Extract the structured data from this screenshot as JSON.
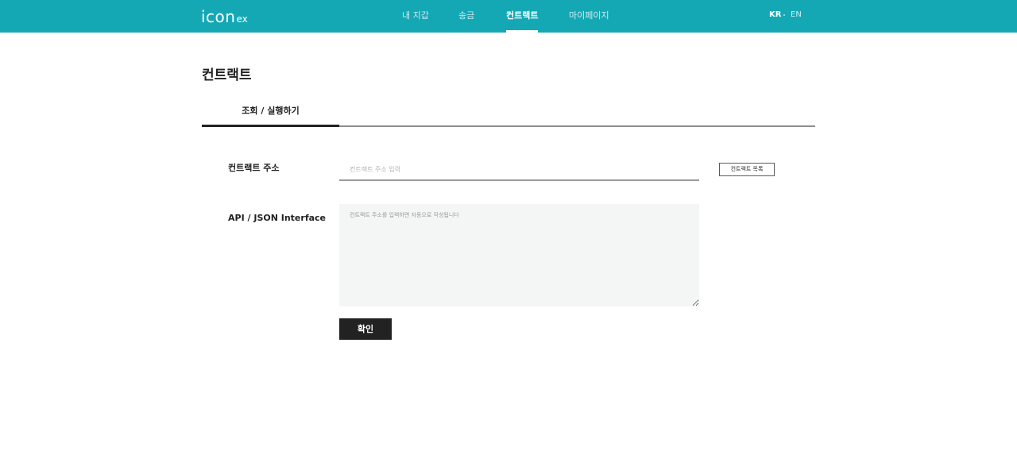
{
  "header": {
    "logo": {
      "main": "icon",
      "sub": "ex"
    },
    "nav": [
      {
        "label": "내 지갑",
        "active": false
      },
      {
        "label": "송금",
        "active": false
      },
      {
        "label": "컨트랙트",
        "active": true
      },
      {
        "label": "마이페이지",
        "active": false
      }
    ],
    "languages": [
      {
        "label": "KR",
        "active": true
      },
      {
        "label": "EN",
        "active": false
      }
    ],
    "brand_color": "#14a8b5"
  },
  "page": {
    "title": "컨트랙트",
    "tabs": [
      {
        "label": "조회 / 실행하기",
        "active": true
      }
    ]
  },
  "form": {
    "address_label": "컨트랙트 주소",
    "address_placeholder": "컨트랙트 주소 입력",
    "address_value": "",
    "contract_list_button": "컨트랙트 목록",
    "interface_label": "API / JSON Interface",
    "interface_placeholder": "컨트랙트 주소를 입력하면 자동으로 작성됩니다",
    "confirm_button": "확인"
  }
}
